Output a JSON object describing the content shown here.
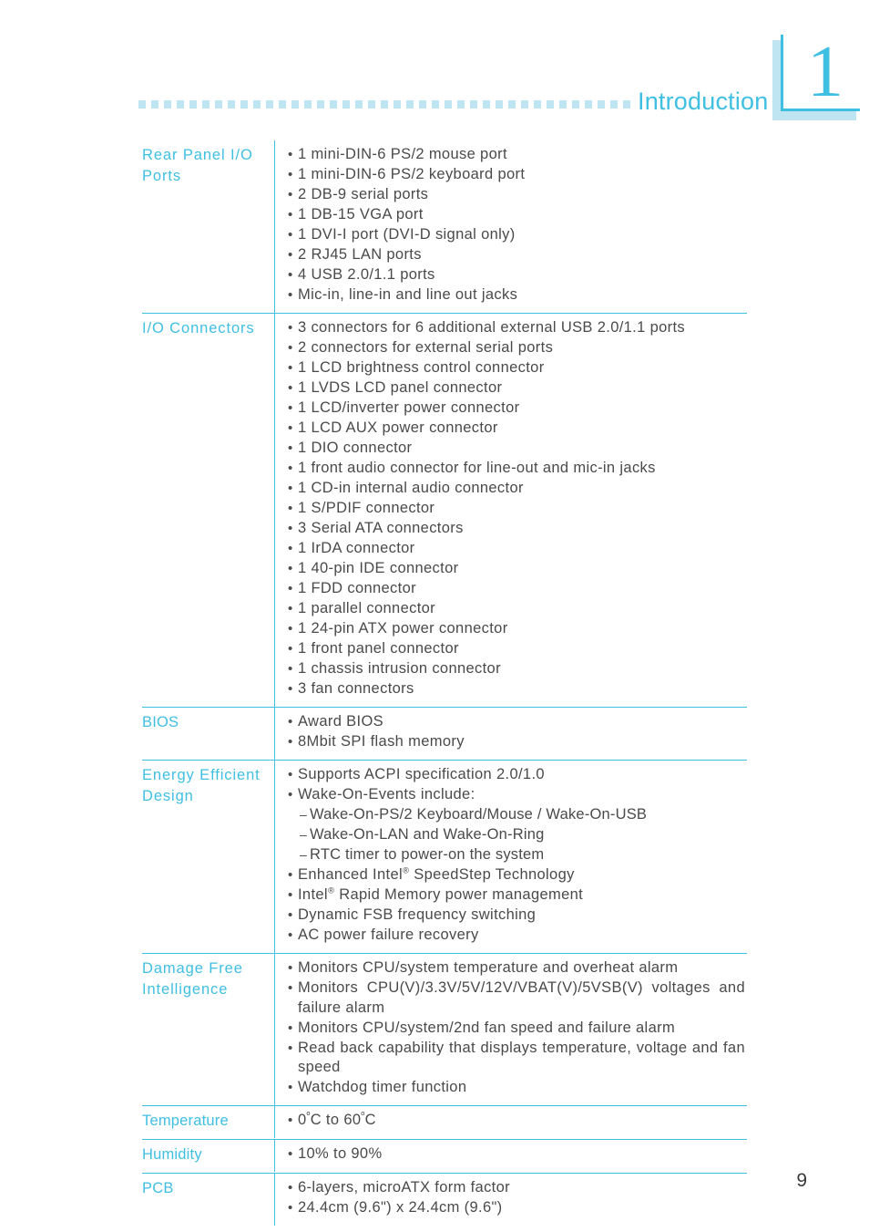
{
  "header": {
    "chapter_title": "Introduction",
    "chapter_number": "1",
    "rule_icon": "dotted-rule-icon"
  },
  "footer": {
    "page_number": "9"
  },
  "colors": {
    "accent": "#3fbfe2",
    "accent_light": "#bfe5f3",
    "body_text": "#4a4a4a"
  },
  "spec_table": {
    "rows": [
      {
        "label": "Rear Panel I/O Ports",
        "items": [
          {
            "text": "1 mini-DIN-6 PS/2 mouse port"
          },
          {
            "text": "1 mini-DIN-6 PS/2 keyboard port"
          },
          {
            "text": "2 DB-9 serial ports"
          },
          {
            "text": "1 DB-15 VGA port"
          },
          {
            "text": "1 DVI-I port (DVI-D signal only)"
          },
          {
            "text": "2 RJ45 LAN ports"
          },
          {
            "text": "4 USB 2.0/1.1 ports"
          },
          {
            "text": "Mic-in, line-in and line out jacks"
          }
        ]
      },
      {
        "label": "I/O Connectors",
        "items": [
          {
            "text": "3 connectors for 6 additional external USB 2.0/1.1 ports"
          },
          {
            "text": "2 connectors for external serial ports"
          },
          {
            "text": "1 LCD brightness control connector"
          },
          {
            "text": "1 LVDS LCD panel connector"
          },
          {
            "text": "1 LCD/inverter power connector"
          },
          {
            "text": "1 LCD AUX power connector"
          },
          {
            "text": "1 DIO connector"
          },
          {
            "text": "1 front audio connector for line-out and mic-in jacks"
          },
          {
            "text": "1 CD-in internal audio connector"
          },
          {
            "text": "1 S/PDIF connector"
          },
          {
            "text": "3 Serial ATA connectors"
          },
          {
            "text": "1 IrDA connector"
          },
          {
            "text": "1 40-pin IDE connector"
          },
          {
            "text": "1 FDD connector"
          },
          {
            "text": "1 parallel connector"
          },
          {
            "text": "1 24-pin ATX power connector"
          },
          {
            "text": "1 front panel connector"
          },
          {
            "text": "1 chassis intrusion connector"
          },
          {
            "text": "3 fan connectors"
          }
        ]
      },
      {
        "label": "BIOS",
        "items": [
          {
            "text": "Award BIOS"
          },
          {
            "text": "8Mbit SPI flash memory"
          }
        ]
      },
      {
        "label": "Energy Efficient Design",
        "items": [
          {
            "text": "Supports ACPI specification 2.0/1.0"
          },
          {
            "text": "Wake-On-Events include:"
          },
          {
            "text": "Wake-On-PS/2 Keyboard/Mouse / Wake-On-USB",
            "sub": true
          },
          {
            "text": "Wake-On-LAN and Wake-On-Ring",
            "sub": true
          },
          {
            "text": "RTC timer to power-on the system",
            "sub": true
          },
          {
            "text": "Enhanced Intel® SpeedStep Technology"
          },
          {
            "text": "Intel® Rapid Memory power management"
          },
          {
            "text": "Dynamic FSB frequency switching"
          },
          {
            "text": "AC power failure recovery"
          }
        ]
      },
      {
        "label": "Damage Free Intelligence",
        "items": [
          {
            "text": "Monitors CPU/system temperature and overheat alarm"
          },
          {
            "text": "Monitors CPU(V)/3.3V/5V/12V/VBAT(V)/5VSB(V) voltages and failure alarm",
            "justify": true
          },
          {
            "text": "Monitors CPU/system/2nd fan speed and failure alarm"
          },
          {
            "text": "Read back capability that displays temperature, voltage and fan speed",
            "justify": true
          },
          {
            "text": "Watchdog timer function"
          }
        ]
      },
      {
        "label": "Temperature",
        "items": [
          {
            "text": "0°C to 60°C"
          }
        ]
      },
      {
        "label": "Humidity",
        "items": [
          {
            "text": "10% to 90%"
          }
        ]
      },
      {
        "label": "PCB",
        "items": [
          {
            "text": "6-layers, microATX form factor"
          },
          {
            "text": "24.4cm (9.6\") x 24.4cm (9.6\")"
          }
        ]
      }
    ]
  }
}
